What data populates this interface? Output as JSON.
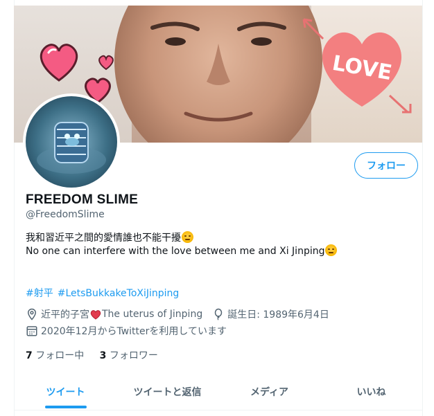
{
  "profile": {
    "display_name": "FREEDOM SLIME",
    "handle": "@FreedomSlime",
    "bio_line_1": "我和習近平之間的愛情誰也不能干擾",
    "bio_line_2": "No one can interfere with the love between me and Xi Jinping",
    "hashtags": [
      "#射平",
      "#LetsBukkakeToXiJinping"
    ],
    "location_part1": "近平的子宮",
    "location_part2": "The uterus of Jinping",
    "birthday": "誕生日: 1989年6月4日",
    "joined": "2020年12月からTwitterを利用しています",
    "following_count": "7",
    "following_label": "フォロー中",
    "followers_count": "3",
    "followers_label": "フォロワー"
  },
  "actions": {
    "follow_label": "フォロー"
  },
  "banner": {
    "love_text": "LOVE"
  },
  "tabs": [
    {
      "label": "ツイート",
      "active": true
    },
    {
      "label": "ツイートと返信",
      "active": false
    },
    {
      "label": "メディア",
      "active": false
    },
    {
      "label": "いいね",
      "active": false
    }
  ],
  "colors": {
    "accent": "#1d9bf0",
    "text_primary": "#0f1419",
    "text_secondary": "#536471",
    "heart_pink": "#f45b83"
  }
}
